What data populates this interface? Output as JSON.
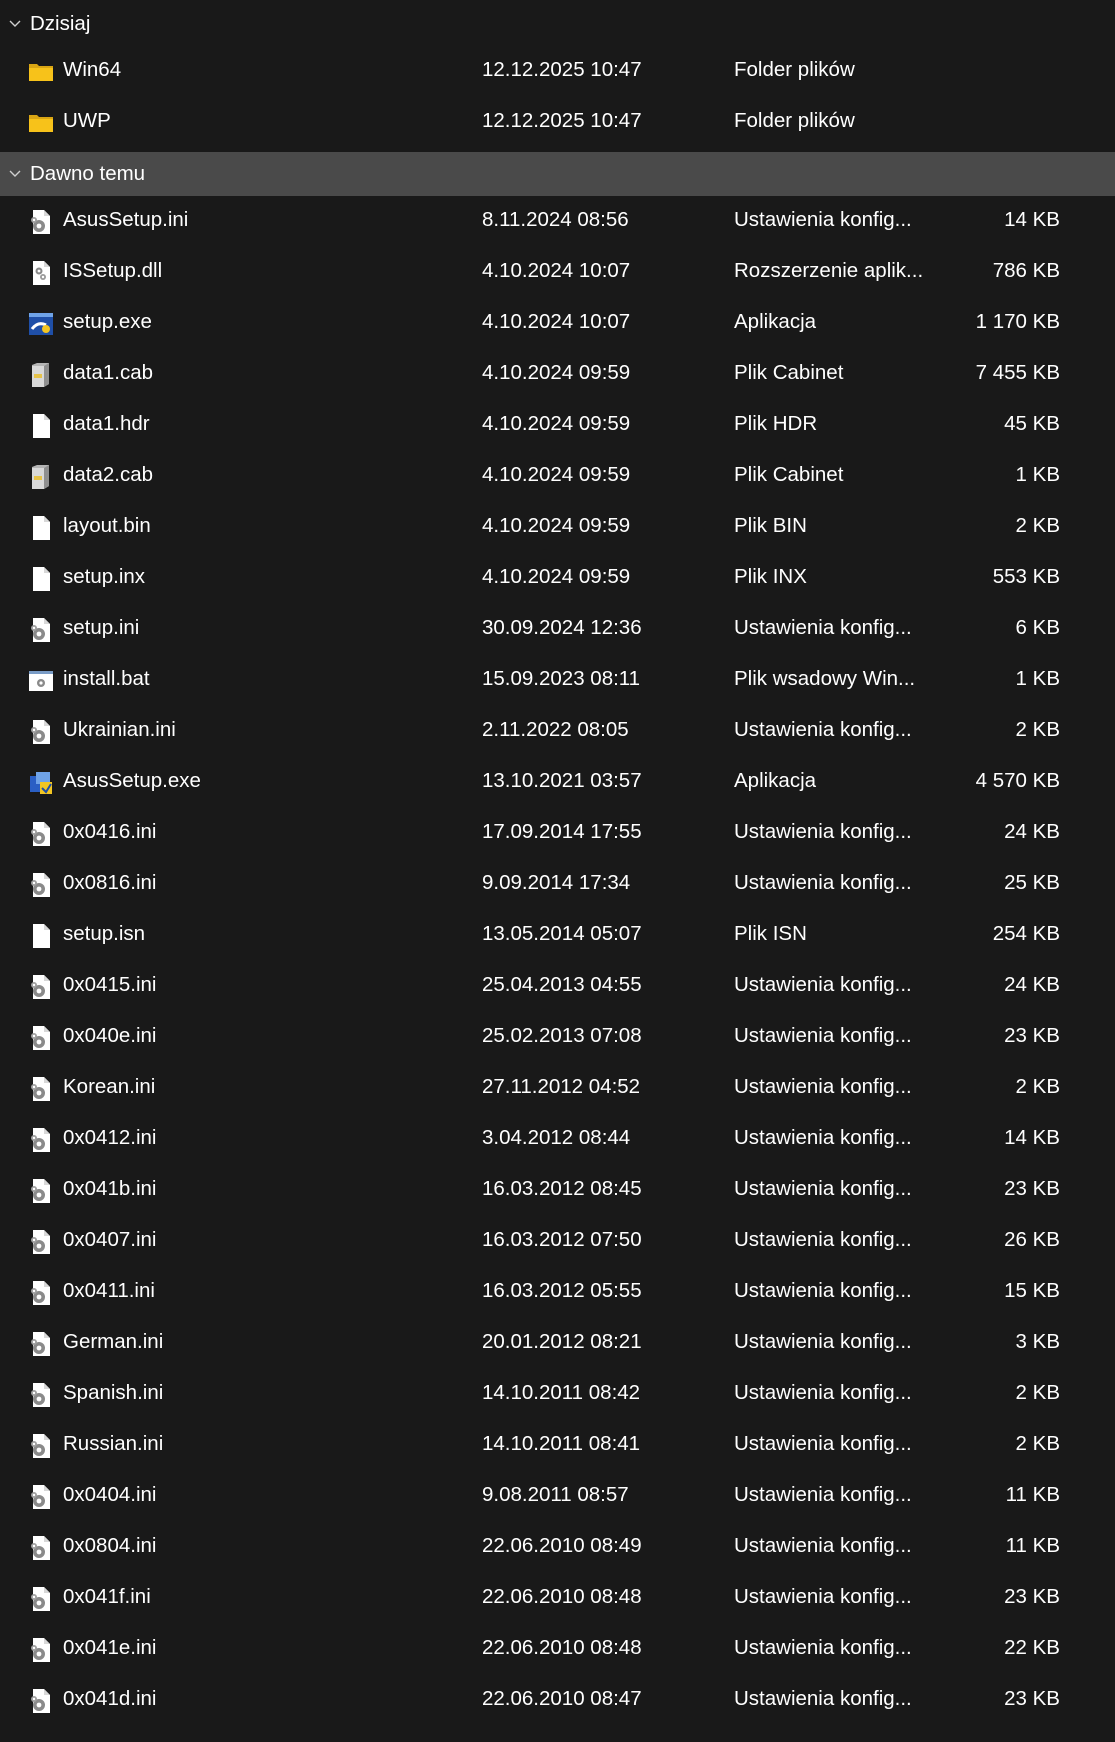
{
  "groups": [
    {
      "label": "Dzisiaj",
      "selected": false,
      "items": [
        {
          "name": "Win64",
          "date": "12.12.2025 10:47",
          "type": "Folder plików",
          "size": "",
          "icon": "folder-icon"
        },
        {
          "name": "UWP",
          "date": "12.12.2025 10:47",
          "type": "Folder plików",
          "size": "",
          "icon": "folder-icon"
        }
      ]
    },
    {
      "label": "Dawno temu",
      "selected": true,
      "items": [
        {
          "name": "AsusSetup.ini",
          "date": "8.11.2024 08:56",
          "type": "Ustawienia konfig...",
          "size": "14 KB",
          "icon": "config-file-icon"
        },
        {
          "name": "ISSetup.dll",
          "date": "4.10.2024 10:07",
          "type": "Rozszerzenie aplik...",
          "size": "786 KB",
          "icon": "dll-file-icon"
        },
        {
          "name": "setup.exe",
          "date": "4.10.2024 10:07",
          "type": "Aplikacja",
          "size": "1 170 KB",
          "icon": "setup-app-icon"
        },
        {
          "name": "data1.cab",
          "date": "4.10.2024 09:59",
          "type": "Plik Cabinet",
          "size": "7 455 KB",
          "icon": "cabinet-file-icon"
        },
        {
          "name": "data1.hdr",
          "date": "4.10.2024 09:59",
          "type": "Plik HDR",
          "size": "45 KB",
          "icon": "blank-file-icon"
        },
        {
          "name": "data2.cab",
          "date": "4.10.2024 09:59",
          "type": "Plik Cabinet",
          "size": "1 KB",
          "icon": "cabinet-file-icon"
        },
        {
          "name": "layout.bin",
          "date": "4.10.2024 09:59",
          "type": "Plik BIN",
          "size": "2 KB",
          "icon": "blank-file-icon"
        },
        {
          "name": "setup.inx",
          "date": "4.10.2024 09:59",
          "type": "Plik INX",
          "size": "553 KB",
          "icon": "blank-file-icon"
        },
        {
          "name": "setup.ini",
          "date": "30.09.2024 12:36",
          "type": "Ustawienia konfig...",
          "size": "6 KB",
          "icon": "config-file-icon"
        },
        {
          "name": "install.bat",
          "date": "15.09.2023 08:11",
          "type": "Plik wsadowy Win...",
          "size": "1 KB",
          "icon": "batch-file-icon"
        },
        {
          "name": "Ukrainian.ini",
          "date": "2.11.2022 08:05",
          "type": "Ustawienia konfig...",
          "size": "2 KB",
          "icon": "config-file-icon"
        },
        {
          "name": "AsusSetup.exe",
          "date": "13.10.2021 03:57",
          "type": "Aplikacja",
          "size": "4 570 KB",
          "icon": "installer-app-icon"
        },
        {
          "name": "0x0416.ini",
          "date": "17.09.2014 17:55",
          "type": "Ustawienia konfig...",
          "size": "24 KB",
          "icon": "config-file-icon"
        },
        {
          "name": "0x0816.ini",
          "date": "9.09.2014 17:34",
          "type": "Ustawienia konfig...",
          "size": "25 KB",
          "icon": "config-file-icon"
        },
        {
          "name": "setup.isn",
          "date": "13.05.2014 05:07",
          "type": "Plik ISN",
          "size": "254 KB",
          "icon": "blank-file-icon"
        },
        {
          "name": "0x0415.ini",
          "date": "25.04.2013 04:55",
          "type": "Ustawienia konfig...",
          "size": "24 KB",
          "icon": "config-file-icon"
        },
        {
          "name": "0x040e.ini",
          "date": "25.02.2013 07:08",
          "type": "Ustawienia konfig...",
          "size": "23 KB",
          "icon": "config-file-icon"
        },
        {
          "name": "Korean.ini",
          "date": "27.11.2012 04:52",
          "type": "Ustawienia konfig...",
          "size": "2 KB",
          "icon": "config-file-icon"
        },
        {
          "name": "0x0412.ini",
          "date": "3.04.2012 08:44",
          "type": "Ustawienia konfig...",
          "size": "14 KB",
          "icon": "config-file-icon"
        },
        {
          "name": "0x041b.ini",
          "date": "16.03.2012 08:45",
          "type": "Ustawienia konfig...",
          "size": "23 KB",
          "icon": "config-file-icon"
        },
        {
          "name": "0x0407.ini",
          "date": "16.03.2012 07:50",
          "type": "Ustawienia konfig...",
          "size": "26 KB",
          "icon": "config-file-icon"
        },
        {
          "name": "0x0411.ini",
          "date": "16.03.2012 05:55",
          "type": "Ustawienia konfig...",
          "size": "15 KB",
          "icon": "config-file-icon"
        },
        {
          "name": "German.ini",
          "date": "20.01.2012 08:21",
          "type": "Ustawienia konfig...",
          "size": "3 KB",
          "icon": "config-file-icon"
        },
        {
          "name": "Spanish.ini",
          "date": "14.10.2011 08:42",
          "type": "Ustawienia konfig...",
          "size": "2 KB",
          "icon": "config-file-icon"
        },
        {
          "name": "Russian.ini",
          "date": "14.10.2011 08:41",
          "type": "Ustawienia konfig...",
          "size": "2 KB",
          "icon": "config-file-icon"
        },
        {
          "name": "0x0404.ini",
          "date": "9.08.2011 08:57",
          "type": "Ustawienia konfig...",
          "size": "11 KB",
          "icon": "config-file-icon"
        },
        {
          "name": "0x0804.ini",
          "date": "22.06.2010 08:49",
          "type": "Ustawienia konfig...",
          "size": "11 KB",
          "icon": "config-file-icon"
        },
        {
          "name": "0x041f.ini",
          "date": "22.06.2010 08:48",
          "type": "Ustawienia konfig...",
          "size": "23 KB",
          "icon": "config-file-icon"
        },
        {
          "name": "0x041e.ini",
          "date": "22.06.2010 08:48",
          "type": "Ustawienia konfig...",
          "size": "22 KB",
          "icon": "config-file-icon"
        },
        {
          "name": "0x041d.ini",
          "date": "22.06.2010 08:47",
          "type": "Ustawienia konfig...",
          "size": "23 KB",
          "icon": "config-file-icon"
        }
      ]
    }
  ],
  "colors": {
    "background": "#191919",
    "selected_header": "#4a4a4a",
    "text": "#ffffff",
    "folder": "#f7c21a"
  }
}
